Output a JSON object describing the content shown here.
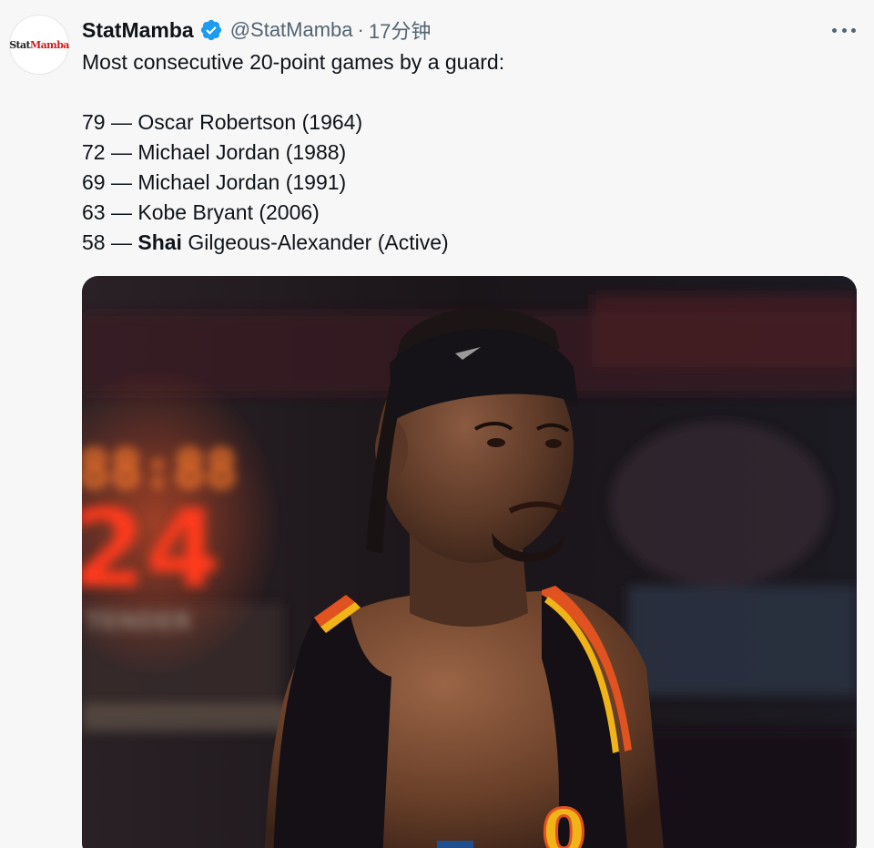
{
  "author": {
    "avatar_text_1": "Stat",
    "avatar_text_2": "Mamba",
    "display_name": "StatMamba",
    "verified": true,
    "handle": "@StatMamba",
    "separator": "·",
    "timestamp": "17分钟"
  },
  "tweet": {
    "intro": "Most consecutive 20-point games by a guard:",
    "entries": [
      {
        "count": "79",
        "dash": " — ",
        "name": "Oscar Robertson (1964)"
      },
      {
        "count": "72",
        "dash": " — ",
        "name": "Michael Jordan (1988)"
      },
      {
        "count": "69",
        "dash": " — ",
        "name": "Michael Jordan (1991)"
      },
      {
        "count": "63",
        "dash": " — ",
        "name": "Kobe Bryant (2006)"
      },
      {
        "count": "58",
        "dash": " — ",
        "name_bold": "Shai",
        "name_rest": " Gilgeous-Alexander (Active)"
      }
    ]
  },
  "media": {
    "icon": "photo",
    "scoreboard_top": "88:88",
    "scoreboard_main": "24",
    "sponsor_text": "TENDER",
    "jersey_number": "0"
  },
  "colors": {
    "text_primary": "#0f1419",
    "text_secondary": "#536471",
    "verified_blue": "#1d9bf0",
    "background": "#f7f7f8"
  }
}
